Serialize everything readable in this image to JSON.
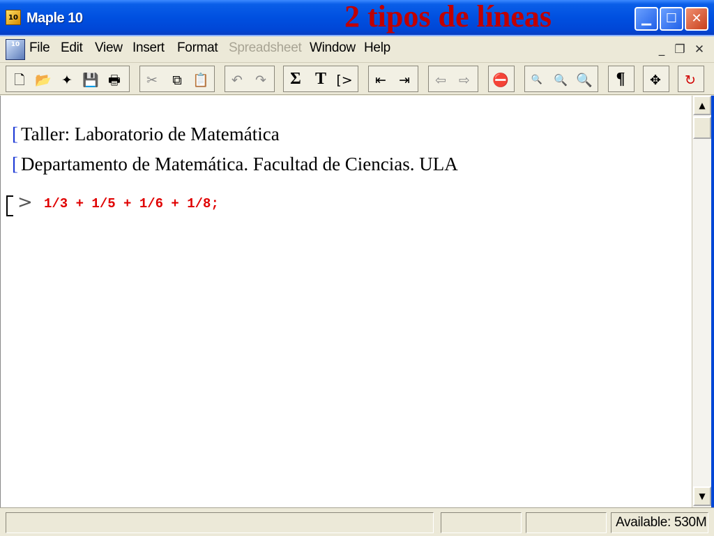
{
  "window": {
    "app_title": "Maple 10",
    "app_icon_text": "10",
    "overlay_title": "2 tipos de líneas",
    "buttons": {
      "minimize": "▁",
      "maximize": "☐",
      "close": "✕"
    }
  },
  "menubar": {
    "doc_icon_text": "10",
    "items": [
      {
        "label": "File",
        "enabled": true
      },
      {
        "label": "Edit",
        "enabled": true
      },
      {
        "label": "View",
        "enabled": true
      },
      {
        "label": "Insert",
        "enabled": true
      },
      {
        "label": "Format",
        "enabled": true
      },
      {
        "label": "Spreadsheet",
        "enabled": false
      },
      {
        "label": "Window",
        "enabled": true
      },
      {
        "label": "Help",
        "enabled": true
      }
    ],
    "mdi_buttons": {
      "minimize": "_",
      "restore": "❐",
      "close": "✕"
    }
  },
  "toolbar": {
    "icons": {
      "new": "🗋",
      "open": "📂",
      "save_all": "✦",
      "save": "💾",
      "print": "🖶",
      "cut": "✂",
      "copy": "⧉",
      "paste": "📋",
      "undo": "↶",
      "redo": "↷",
      "sigma": "Σ",
      "text": "T",
      "execution_group": "[>",
      "indent_out": "⇤",
      "indent_in": "⇥",
      "back": "⇦",
      "forward": "⇨",
      "stop": "⛔",
      "zoom_small": "🔍",
      "zoom_medium": "🔍",
      "zoom_large": "🔍",
      "pilcrow": "¶",
      "move": "✥",
      "restart": "↻"
    }
  },
  "document": {
    "text_bracket": "[",
    "lines": [
      "Taller: Laboratorio de Matemática",
      "Departamento de Matemática. Facultad de Ciencias. ULA"
    ],
    "prompt": ">",
    "input": "1/3 + 1/5 + 1/6 + 1/8;"
  },
  "scrollbar": {
    "up": "▲",
    "down": "▼"
  },
  "statusbar": {
    "memory": "Available: 530M"
  }
}
